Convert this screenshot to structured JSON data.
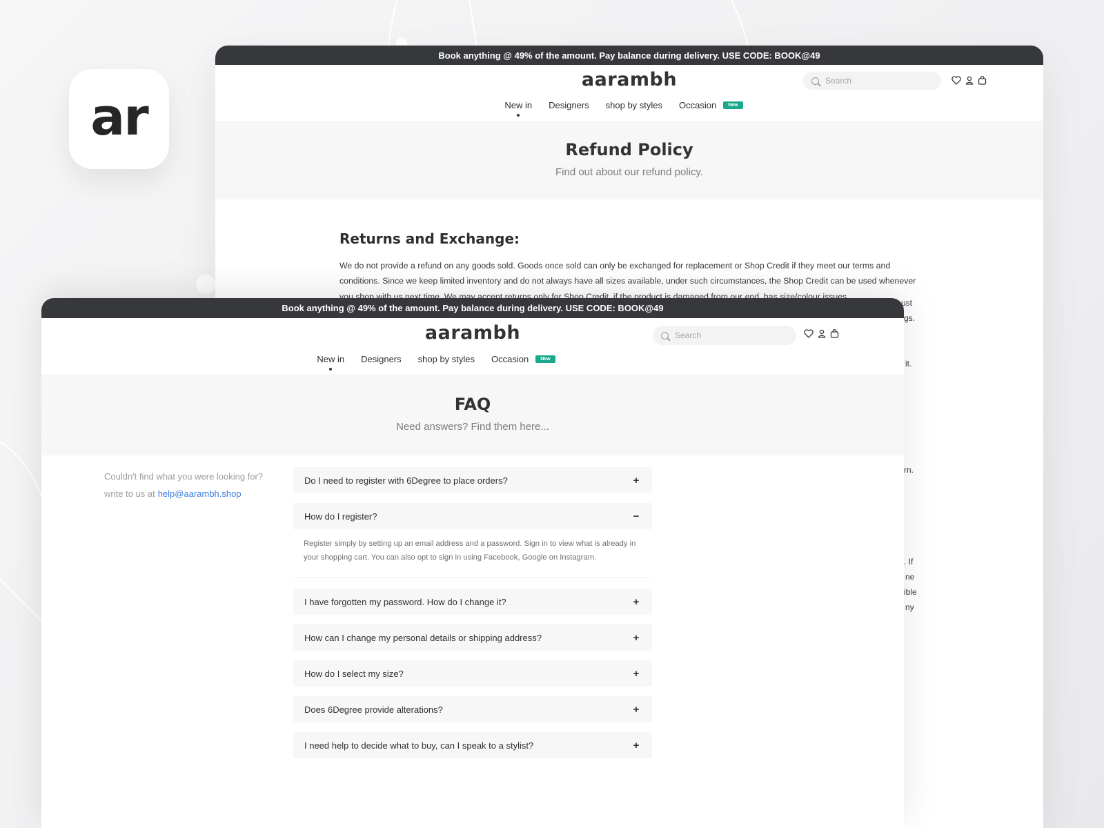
{
  "app_icon": {
    "text": "ar"
  },
  "colors": {
    "announce_bg": "#37383c",
    "badge_new": "#19a88c",
    "link": "#3c7ee0"
  },
  "back_window": {
    "announcement": "Book anything @ 49% of the amount. Pay balance during delivery. USE CODE: BOOK@49",
    "logo": "aarambh",
    "search": {
      "placeholder": "Search"
    },
    "icons": [
      "heart-icon",
      "user-icon",
      "bag-icon"
    ],
    "nav": [
      {
        "label": "New in",
        "active": true
      },
      {
        "label": "Designers"
      },
      {
        "label": "shop by styles"
      },
      {
        "label": "Occasion",
        "badge": "New"
      }
    ],
    "hero": {
      "title": "Refund Policy",
      "subtitle": "Find out about our refund policy."
    },
    "section_title": "Returns and Exchange:",
    "body": "We do not provide a refund on any goods sold. Goods once sold can only be exchanged for replacement or Shop Credit if they meet our terms and conditions. Since we keep limited inventory and do not always have all sizes available, under such circumstances, the Shop Credit can be used whenever you shop with us next time. We may accept returns only for Shop Credit, if the product is damaged from our end, has size/colour issues",
    "visible_fragments": [
      "ust",
      "gs.",
      "it.",
      "rn.",
      ". If",
      "ne",
      "ible",
      "ny"
    ]
  },
  "front_window": {
    "announcement": "Book anything @ 49% of the amount. Pay balance during delivery. USE CODE: BOOK@49",
    "logo": "aarambh",
    "search": {
      "placeholder": "Search"
    },
    "icons": [
      "heart-icon",
      "user-icon",
      "bag-icon"
    ],
    "nav": [
      {
        "label": "New in",
        "active": true
      },
      {
        "label": "Designers"
      },
      {
        "label": "shop by styles"
      },
      {
        "label": "Occasion",
        "badge": "New"
      }
    ],
    "hero": {
      "title": "FAQ",
      "subtitle": "Need answers? Find them here..."
    },
    "sidebar": {
      "line1": "Couldn't find what you were looking for?",
      "line2": "write to us at",
      "email": "help@aarambh.shop"
    },
    "faq": [
      {
        "question": "Do I need to register with 6Degree to place orders?",
        "open": false,
        "toggle": "+"
      },
      {
        "question": "How do I register?",
        "open": true,
        "toggle": "−",
        "answer": "Register simply by setting up an email address and a password. Sign in to view what is already in your shopping cart. You can also opt to sign in using Facebook, Google on Instagram."
      },
      {
        "question": "I have forgotten my password. How do I change it?",
        "open": false,
        "toggle": "+"
      },
      {
        "question": "How can I change my personal details or shipping address?",
        "open": false,
        "toggle": "+"
      },
      {
        "question": "How do I select my size?",
        "open": false,
        "toggle": "+"
      },
      {
        "question": "Does 6Degree provide alterations?",
        "open": false,
        "toggle": "+"
      },
      {
        "question": "I need help to decide what to buy, can I speak to a stylist?",
        "open": false,
        "toggle": "+"
      }
    ]
  }
}
